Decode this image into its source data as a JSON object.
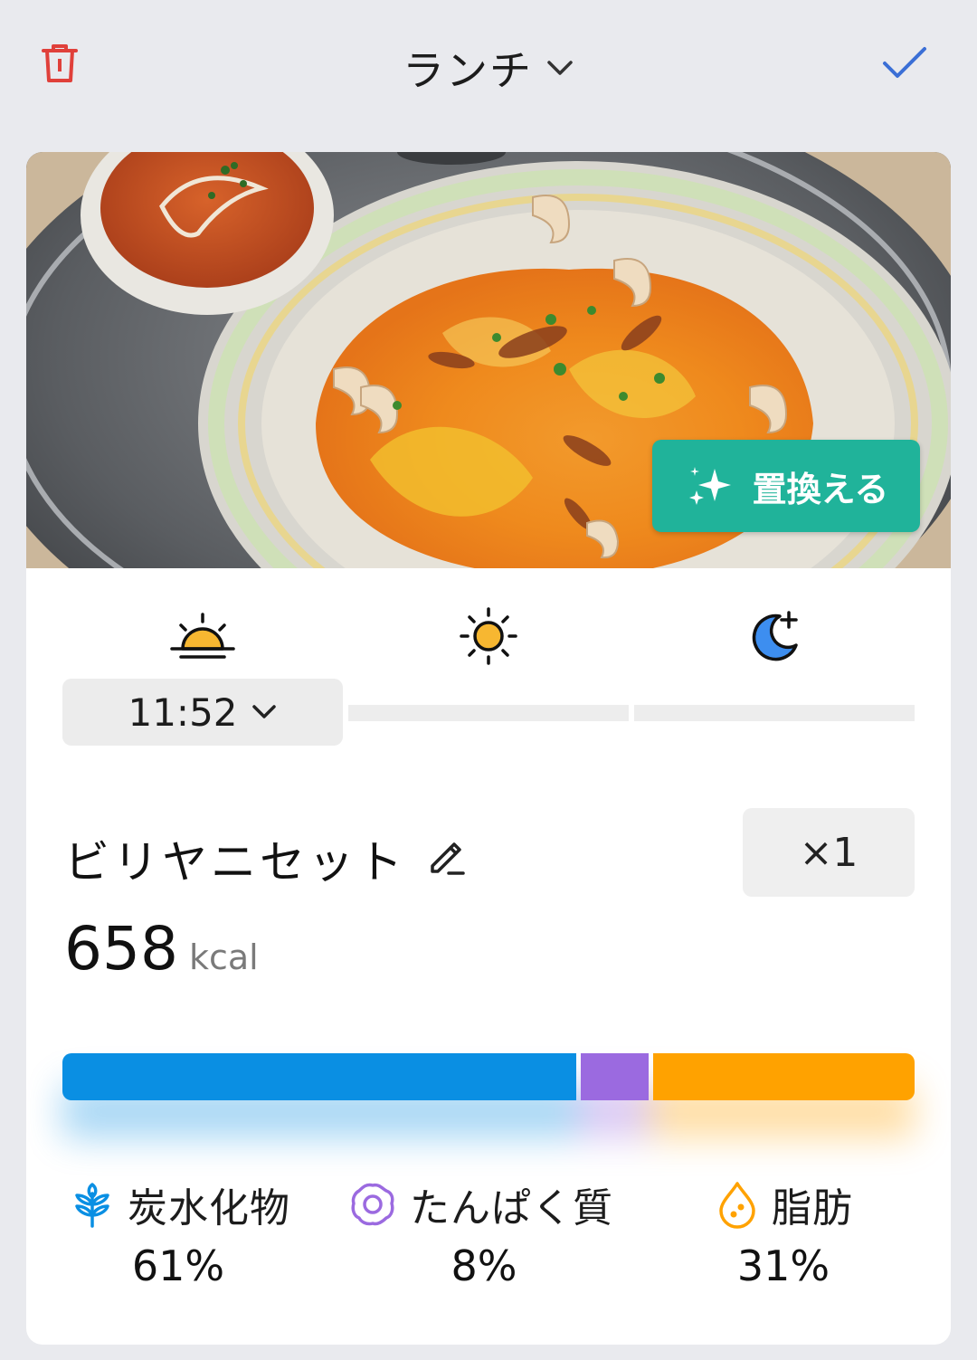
{
  "header": {
    "title": "ランチ",
    "delete_icon": "trash-icon",
    "confirm_icon": "check-icon"
  },
  "photo": {
    "description_icon": "food-photo",
    "replace_label": "置換える",
    "replace_icon": "sparkle-icon"
  },
  "time_of_day": {
    "slots": [
      {
        "icon": "sunrise-icon",
        "color": "#f7b731"
      },
      {
        "icon": "sun-icon",
        "color": "#f7b731"
      },
      {
        "icon": "moon-icon",
        "color": "#3d8ef0"
      }
    ],
    "selected_time": "11:52"
  },
  "food": {
    "name": "ビリヤニセット",
    "quantity": "×1",
    "kcal_value": "658",
    "kcal_unit": "kcal"
  },
  "macros": [
    {
      "name": "炭水化物",
      "percent": "61%",
      "fraction": 0.61,
      "color": "#0a8fe3",
      "icon": "wheat-icon"
    },
    {
      "name": "たんぱく質",
      "percent": "8%",
      "fraction": 0.08,
      "color": "#9b6ae0",
      "icon": "egg-icon"
    },
    {
      "name": "脂肪",
      "percent": "31%",
      "fraction": 0.31,
      "color": "#ffa200",
      "icon": "drop-icon"
    }
  ],
  "colors": {
    "background": "#e9eaee",
    "delete": "#e0403a",
    "confirm": "#3b6fd6",
    "replace_button": "#20b39a"
  }
}
